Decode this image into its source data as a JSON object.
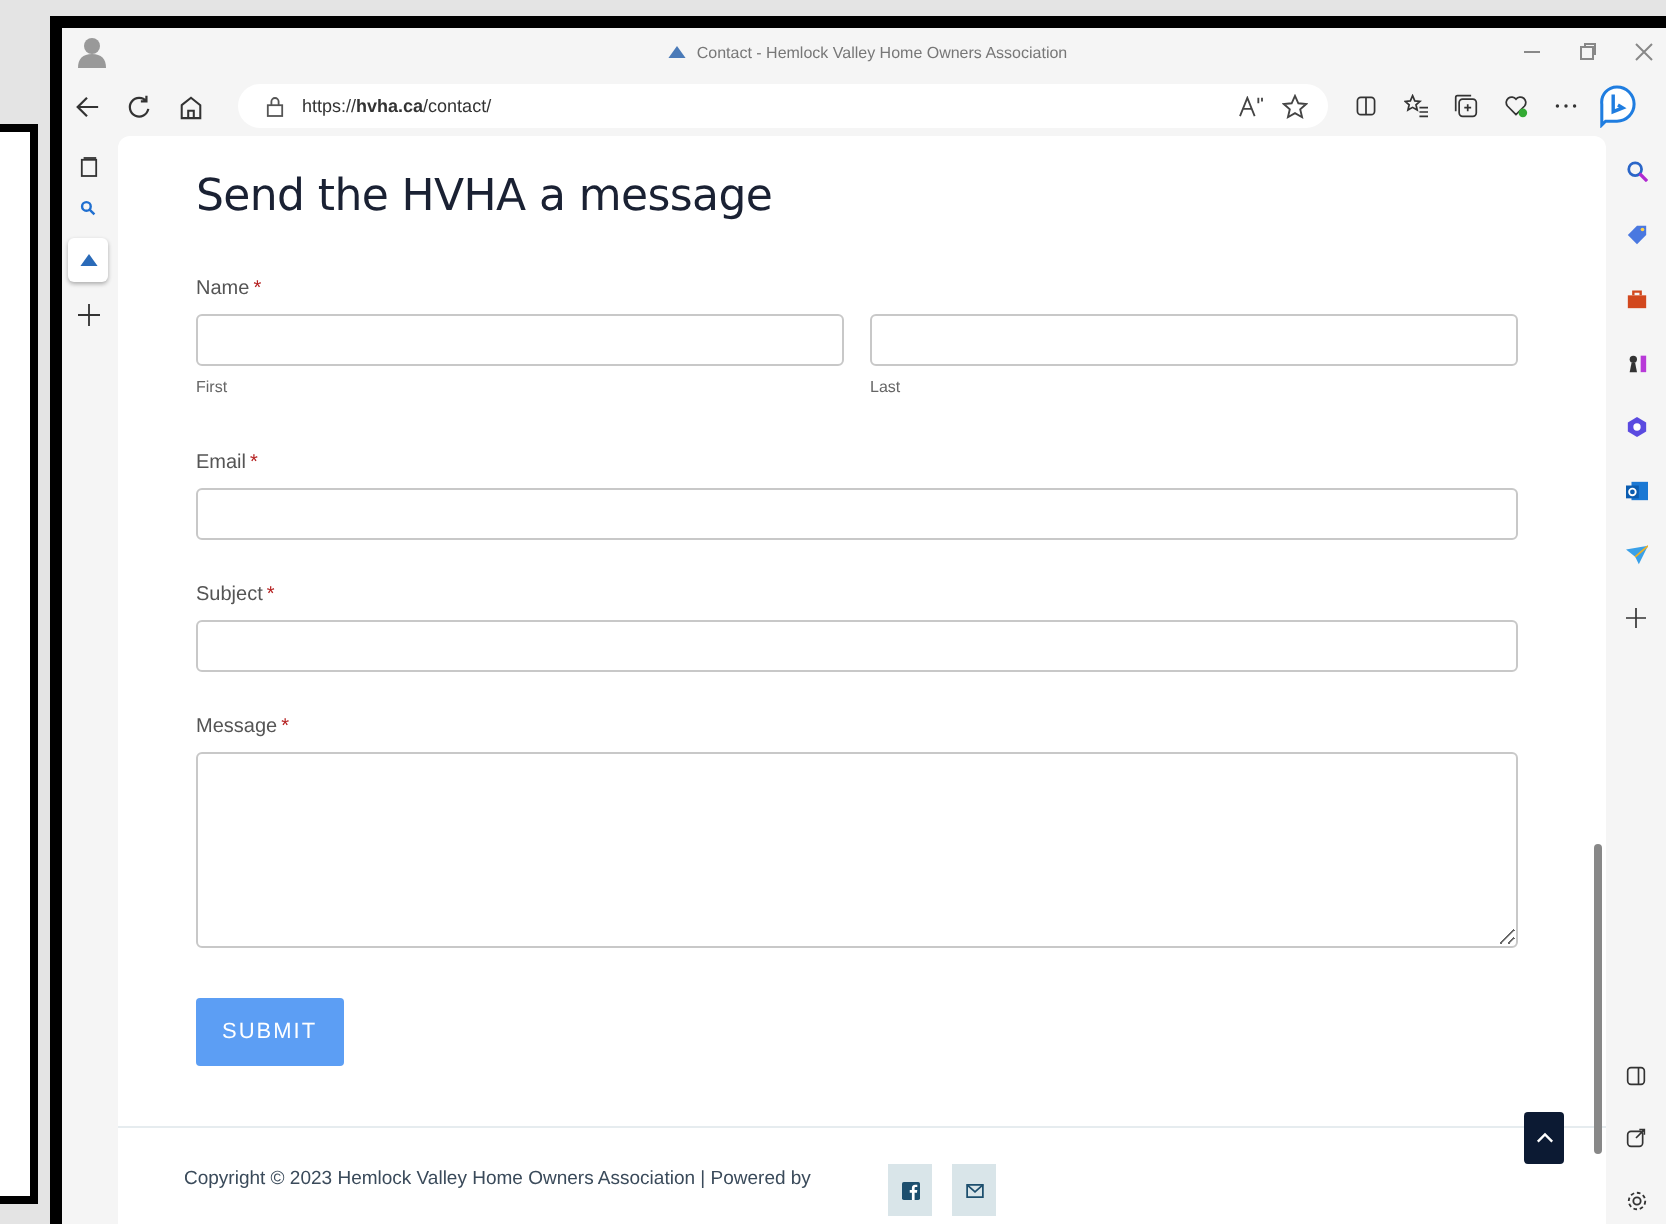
{
  "browser": {
    "tab_title": "Contact - Hemlock Valley Home Owners Association",
    "url": "https://**hvha.ca**/contact/"
  },
  "page": {
    "heading": "Send the HVHA a message",
    "form": {
      "required_mark": "*",
      "fields": [
        {
          "kind": "name",
          "label": "Name",
          "required": true,
          "sublabels": [
            "First",
            "Last"
          ]
        },
        {
          "kind": "text",
          "label": "Email",
          "required": true
        },
        {
          "kind": "text",
          "label": "Subject",
          "required": true
        },
        {
          "kind": "textarea",
          "label": "Message",
          "required": true
        }
      ],
      "submit": "SUBMIT"
    },
    "footer": {
      "copyright": "Copyright © 2023 Hemlock Valley Home Owners Association | Powered by"
    }
  }
}
